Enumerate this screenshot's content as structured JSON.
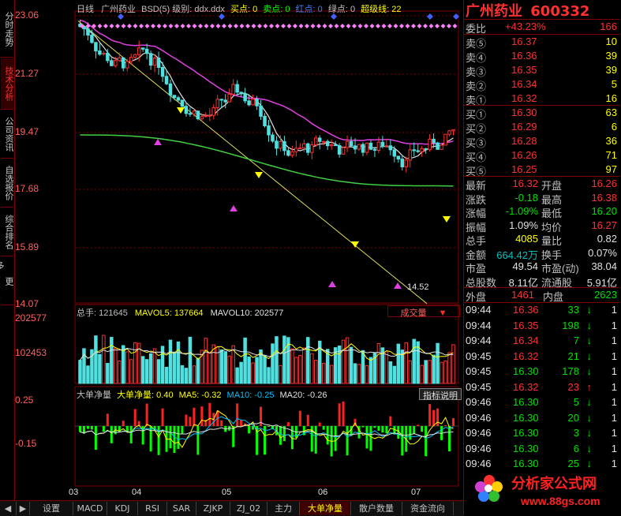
{
  "left_tabs": [
    {
      "label": "分时走势",
      "active": false
    },
    {
      "label": "技术分析",
      "active": true
    },
    {
      "label": "公司资讯",
      "active": false
    },
    {
      "label": "自选报价",
      "active": false
    },
    {
      "label": "综合排名",
      "active": false
    },
    {
      "label": "更多...",
      "active": false
    }
  ],
  "kline_legend": {
    "period": "日线",
    "name": "广州药业",
    "indicator": "BSD(5) 级别: ddx.ddx",
    "buy": "买点: 0",
    "sell": "卖点: 0",
    "red": "红点: 0",
    "green": "绿点: 0",
    "super": "超级线: 22"
  },
  "price_axis": [
    "23.06",
    "21.27",
    "19.47",
    "17.68",
    "15.89",
    "14.07"
  ],
  "low_marker": "14.52",
  "volume_legend": {
    "total": "总手: 121645",
    "mavol5": "MAVOL5: 137664",
    "mavol10": "MAVOL10: 202577"
  },
  "volume_axis": [
    "202577",
    "102453"
  ],
  "volume_button": "成交量",
  "ind_legend": {
    "name": "大单净量",
    "value": "大单净量: 0.40",
    "ma5": "MA5: -0.32",
    "ma10": "MA10: -0.25",
    "ma20": "MA20: -0.26"
  },
  "ind_axis": [
    "0.25",
    "-0.15"
  ],
  "ind_help": "指标说明",
  "x_labels": [
    "03",
    "04",
    "05",
    "06",
    "07"
  ],
  "bottom_tabs": [
    {
      "label": "设置",
      "active": false
    },
    {
      "label": "MACD",
      "active": false
    },
    {
      "label": "KDJ",
      "active": false
    },
    {
      "label": "RSI",
      "active": false
    },
    {
      "label": "SAR",
      "active": false
    },
    {
      "label": "ZJKP",
      "active": false
    },
    {
      "label": "ZJ_02",
      "active": false
    },
    {
      "label": "主力",
      "active": false
    },
    {
      "label": "大单净量",
      "active": true
    },
    {
      "label": "散户数量",
      "active": false
    },
    {
      "label": "资金流向",
      "active": false
    }
  ],
  "quote": {
    "stock_name": "广州药业",
    "code": "600332",
    "weibi_label": "委比",
    "weibi": "+43.23%",
    "weicha": "166",
    "sells": [
      {
        "label": "卖⑤",
        "price": "16.37",
        "vol": "10"
      },
      {
        "label": "卖④",
        "price": "16.36",
        "vol": "39"
      },
      {
        "label": "卖③",
        "price": "16.35",
        "vol": "39"
      },
      {
        "label": "卖②",
        "price": "16.34",
        "vol": "5"
      },
      {
        "label": "卖①",
        "price": "16.32",
        "vol": "16"
      }
    ],
    "buys": [
      {
        "label": "买①",
        "price": "16.30",
        "vol": "63"
      },
      {
        "label": "买②",
        "price": "16.29",
        "vol": "6"
      },
      {
        "label": "买③",
        "price": "16.28",
        "vol": "36"
      },
      {
        "label": "买④",
        "price": "16.26",
        "vol": "71"
      },
      {
        "label": "买⑤",
        "price": "16.25",
        "vol": "97"
      }
    ],
    "stats": [
      {
        "l1": "最新",
        "v1": "16.32",
        "c1": "red",
        "l2": "开盘",
        "v2": "16.26",
        "c2": "red"
      },
      {
        "l1": "涨跌",
        "v1": "-0.18",
        "c1": "green",
        "l2": "最高",
        "v2": "16.38",
        "c2": "red"
      },
      {
        "l1": "涨幅",
        "v1": "-1.09%",
        "c1": "green",
        "l2": "最低",
        "v2": "16.20",
        "c2": "green"
      },
      {
        "l1": "振幅",
        "v1": "1.09%",
        "c1": "white",
        "l2": "均价",
        "v2": "16.27",
        "c2": "red"
      },
      {
        "l1": "总手",
        "v1": "4085",
        "c1": "yellow",
        "l2": "量比",
        "v2": "0.82",
        "c2": "white"
      },
      {
        "l1": "金额",
        "v1": "664.42万",
        "c1": "cyan",
        "l2": "换手",
        "v2": "0.07%",
        "c2": "white"
      },
      {
        "l1": "市盈",
        "v1": "49.54",
        "c1": "white",
        "l2": "市盈(动)",
        "v2": "38.04",
        "c2": "white"
      },
      {
        "l1": "总股数",
        "v1": "8.11亿",
        "c1": "white",
        "l2": "流通股",
        "v2": "5.91亿",
        "c2": "white"
      }
    ],
    "outer_label": "外盘",
    "outer": "1461",
    "inner_label": "内盘",
    "inner": "2623",
    "ticks": [
      {
        "time": "09:44",
        "price": "16.36",
        "vol": "33",
        "dir": "down",
        "n": "1"
      },
      {
        "time": "09:44",
        "price": "16.35",
        "vol": "198",
        "dir": "down",
        "n": "1"
      },
      {
        "time": "09:44",
        "price": "16.34",
        "vol": "7",
        "dir": "down",
        "n": "1"
      },
      {
        "time": "09:45",
        "price": "16.32",
        "vol": "21",
        "dir": "down",
        "n": "1"
      },
      {
        "time": "09:45",
        "price": "16.30",
        "vol": "178",
        "dir": "down",
        "n": "1"
      },
      {
        "time": "09:45",
        "price": "16.32",
        "vol": "23",
        "dir": "up",
        "n": "1"
      },
      {
        "time": "09:46",
        "price": "16.30",
        "vol": "5",
        "dir": "down",
        "n": "1"
      },
      {
        "time": "09:46",
        "price": "16.30",
        "vol": "20",
        "dir": "down",
        "n": "1"
      },
      {
        "time": "09:46",
        "price": "16.30",
        "vol": "3",
        "dir": "down",
        "n": "1"
      },
      {
        "time": "09:46",
        "price": "16.30",
        "vol": "6",
        "dir": "down",
        "n": "1"
      },
      {
        "time": "09:46",
        "price": "16.30",
        "vol": "25",
        "dir": "down",
        "n": "1"
      }
    ]
  },
  "watermark": {
    "title": "分析家公式网",
    "url": "www.88gs.com"
  },
  "colors": {
    "up": "#ff3030",
    "down": "#50e0e0",
    "ma_white": "#e0e0e0",
    "ma_magenta": "#e040e0",
    "ma_green": "#40d040",
    "trend": "#e0e060"
  }
}
